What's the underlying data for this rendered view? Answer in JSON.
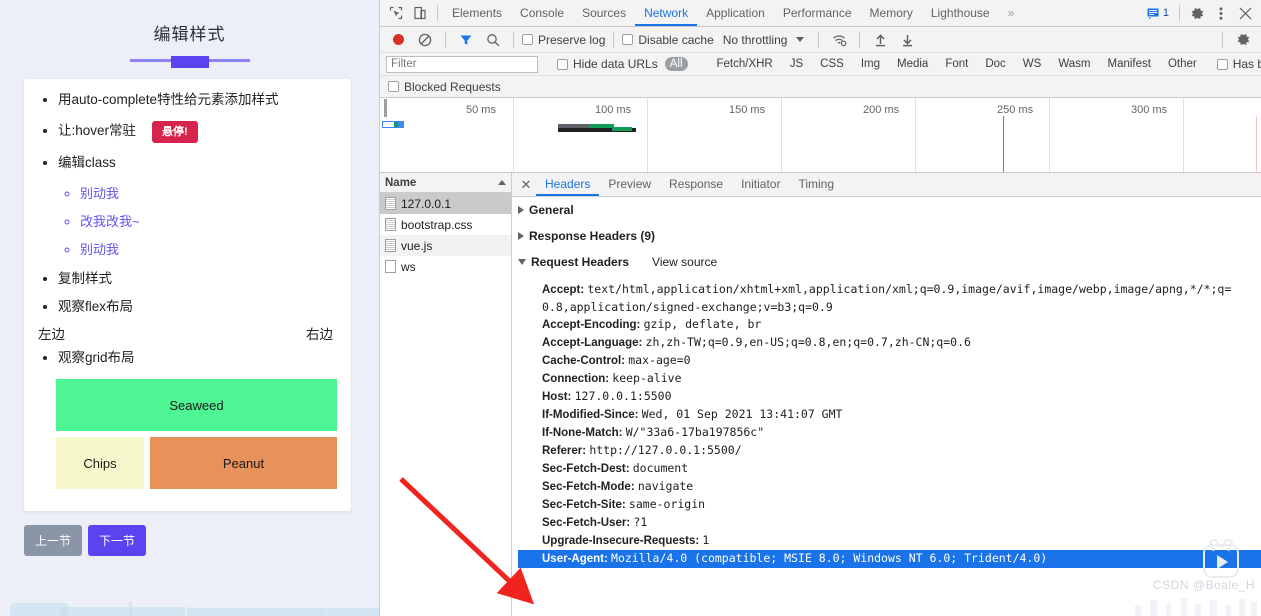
{
  "page": {
    "title": "编辑样式",
    "items": [
      "用auto-complete特性给元素添加样式",
      "让:hover常驻",
      "编辑class",
      "复制样式",
      "观察flex布局",
      "观察grid布局"
    ],
    "hover_badge": "悬停!",
    "class_sublist": [
      "别动我",
      "改我改我~",
      "别动我"
    ],
    "flex_demo": {
      "left": "左边",
      "right": "右边"
    },
    "grid_demo": {
      "cells": [
        {
          "label": "Seaweed",
          "color": "#4df593"
        },
        {
          "label": "Chips",
          "color": "#f7f7cc"
        },
        {
          "label": "Peanut",
          "color": "#e7925a"
        }
      ]
    },
    "buttons": {
      "prev": {
        "label": "上一节",
        "color": "#8a95a8"
      },
      "next": {
        "label": "下一节",
        "color": "#5b43f0"
      }
    },
    "accent": "#5b43f0"
  },
  "devtools": {
    "panel_tabs": [
      "Elements",
      "Console",
      "Sources",
      "Network",
      "Application",
      "Performance",
      "Memory",
      "Lighthouse"
    ],
    "active_panel_tab": "Network",
    "more_tabs_glyph": "»",
    "message_count": "1",
    "icons": {
      "inspect": "inspect-element-icon",
      "device": "device-toolbar-icon",
      "messages": "messages-icon",
      "settings": "gear-icon",
      "more": "kebab-menu-icon",
      "close": "close-icon"
    },
    "toolbar": {
      "record": "record-button",
      "clear": "clear-button",
      "filter": "filter-funnel-icon",
      "search": "search-icon",
      "preserve_log": "Preserve log",
      "disable_cache": "Disable cache",
      "throttling": "No throttling",
      "wifi_icon": "network-conditions-icon",
      "import": "import-har-icon",
      "export": "export-har-icon",
      "settings": "network-settings-gear-icon"
    },
    "filter_row": {
      "placeholder": "Filter",
      "value": "",
      "hide_data_urls": "Hide data URLs",
      "types": [
        "All",
        "Fetch/XHR",
        "JS",
        "CSS",
        "Img",
        "Media",
        "Font",
        "Doc",
        "WS",
        "Wasm",
        "Manifest",
        "Other"
      ],
      "active_type": "All",
      "has_blocked_cookies": "Has blocked cookies",
      "blocked_requests": "Blocked Requests"
    },
    "timeline": {
      "ticks": [
        "50 ms",
        "100 ms",
        "150 ms",
        "200 ms",
        "250 ms",
        "300 ms"
      ]
    },
    "requests": {
      "column_header": "Name",
      "rows": [
        {
          "name": "127.0.0.1",
          "selected": true
        },
        {
          "name": "bootstrap.css",
          "selected": false
        },
        {
          "name": "vue.js",
          "selected": false
        },
        {
          "name": "ws",
          "selected": false
        }
      ]
    },
    "detail_tabs": [
      "Headers",
      "Preview",
      "Response",
      "Initiator",
      "Timing"
    ],
    "active_detail_tab": "Headers",
    "sections": {
      "general": "General",
      "response_headers": "Response Headers (9)",
      "request_headers": "Request Headers",
      "view_source": "View source"
    },
    "request_headers": [
      {
        "key": "Accept:",
        "value": "text/html,application/xhtml+xml,application/xml;q=0.9,image/avif,image/webp,image/apng,*/*;q="
      },
      {
        "key": "",
        "value": "0.8,application/signed-exchange;v=b3;q=0.9",
        "continuation": true
      },
      {
        "key": "Accept-Encoding:",
        "value": "gzip, deflate, br"
      },
      {
        "key": "Accept-Language:",
        "value": "zh,zh-TW;q=0.9,en-US;q=0.8,en;q=0.7,zh-CN;q=0.6"
      },
      {
        "key": "Cache-Control:",
        "value": "max-age=0"
      },
      {
        "key": "Connection:",
        "value": "keep-alive"
      },
      {
        "key": "Host:",
        "value": "127.0.0.1:5500"
      },
      {
        "key": "If-Modified-Since:",
        "value": "Wed, 01 Sep 2021 13:41:07 GMT"
      },
      {
        "key": "If-None-Match:",
        "value": "W/\"33a6-17ba197856c\""
      },
      {
        "key": "Referer:",
        "value": "http://127.0.0.1:5500/"
      },
      {
        "key": "Sec-Fetch-Dest:",
        "value": "document"
      },
      {
        "key": "Sec-Fetch-Mode:",
        "value": "navigate"
      },
      {
        "key": "Sec-Fetch-Site:",
        "value": "same-origin"
      },
      {
        "key": "Sec-Fetch-User:",
        "value": "?1"
      },
      {
        "key": "Upgrade-Insecure-Requests:",
        "value": "1"
      },
      {
        "key": "User-Agent:",
        "value": "Mozilla/4.0 (compatible; MSIE 8.0; Windows NT 6.0; Trident/4.0)",
        "selected": true
      }
    ]
  },
  "overlay": {
    "watermark": "CSDN @Boale_H",
    "arrow": "red-annotation-arrow"
  }
}
